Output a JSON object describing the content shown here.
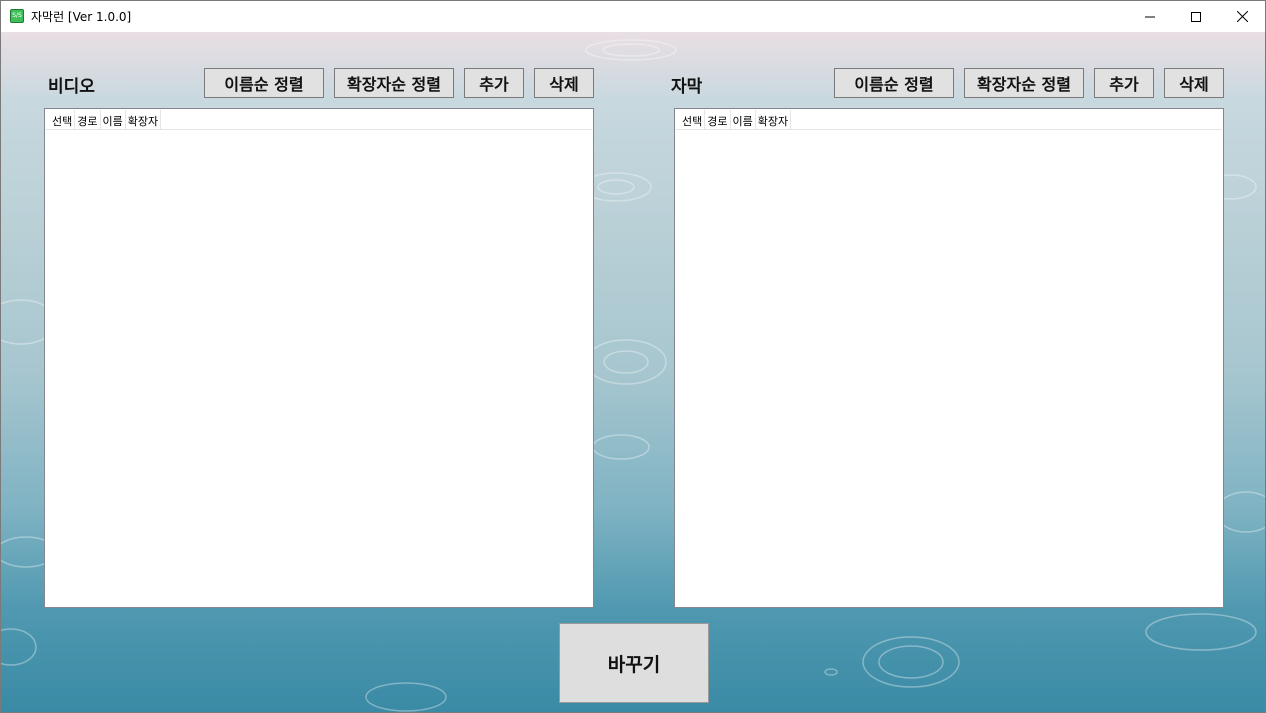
{
  "window": {
    "title": "자막런 [Ver 1.0.0]",
    "icon": "subtitle-app-icon",
    "icon_text": "S/S"
  },
  "video_panel": {
    "label": "비디오",
    "buttons": {
      "sort_name": "이름순 정렬",
      "sort_ext": "확장자순 정렬",
      "add": "추가",
      "delete": "삭제"
    },
    "columns": [
      "선택",
      "경로",
      "이름",
      "확장자"
    ],
    "rows": []
  },
  "subtitle_panel": {
    "label": "자막",
    "buttons": {
      "sort_name": "이름순 정렬",
      "sort_ext": "확장자순 정렬",
      "add": "추가",
      "delete": "삭제"
    },
    "columns": [
      "선택",
      "경로",
      "이름",
      "확장자"
    ],
    "rows": []
  },
  "actions": {
    "change": "바꾸기"
  },
  "colors": {
    "button_bg": "#e1e1e1",
    "list_bg": "#ffffff",
    "water_dark": "#3a8aa5",
    "water_light": "#e9dfe3"
  }
}
